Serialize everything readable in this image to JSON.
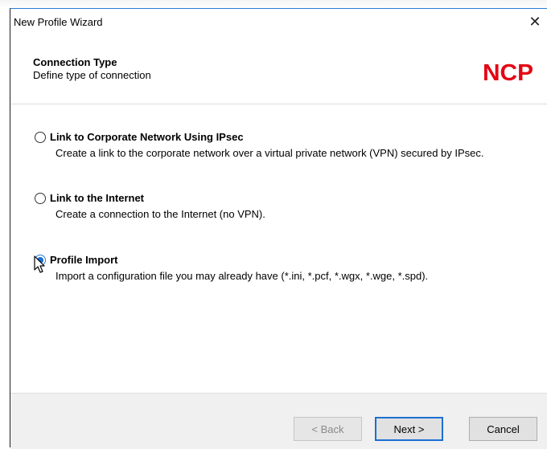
{
  "window": {
    "title": "New Profile Wizard",
    "close_glyph": "✕"
  },
  "header": {
    "title": "Connection Type",
    "subtitle": "Define type of connection",
    "logo_text": "NCP",
    "logo_color": "#e30613"
  },
  "options": [
    {
      "label": "Link to Corporate Network Using IPsec",
      "description": "Create a link to the corporate network over a virtual private network (VPN) secured by IPsec.",
      "checked": false
    },
    {
      "label": "Link to the Internet",
      "description": "Create a connection to the Internet (no VPN).",
      "checked": false
    },
    {
      "label": "Profile Import",
      "description": "Import a configuration file you may already have (*.ini, *.pcf, *.wgx, *.wge, *.spd).",
      "checked": true
    }
  ],
  "footer": {
    "back_label": "< Back",
    "next_label": "Next >",
    "cancel_label": "Cancel"
  },
  "colors": {
    "accent": "#1c6fd2",
    "footer_bg": "#f0f0f0"
  }
}
